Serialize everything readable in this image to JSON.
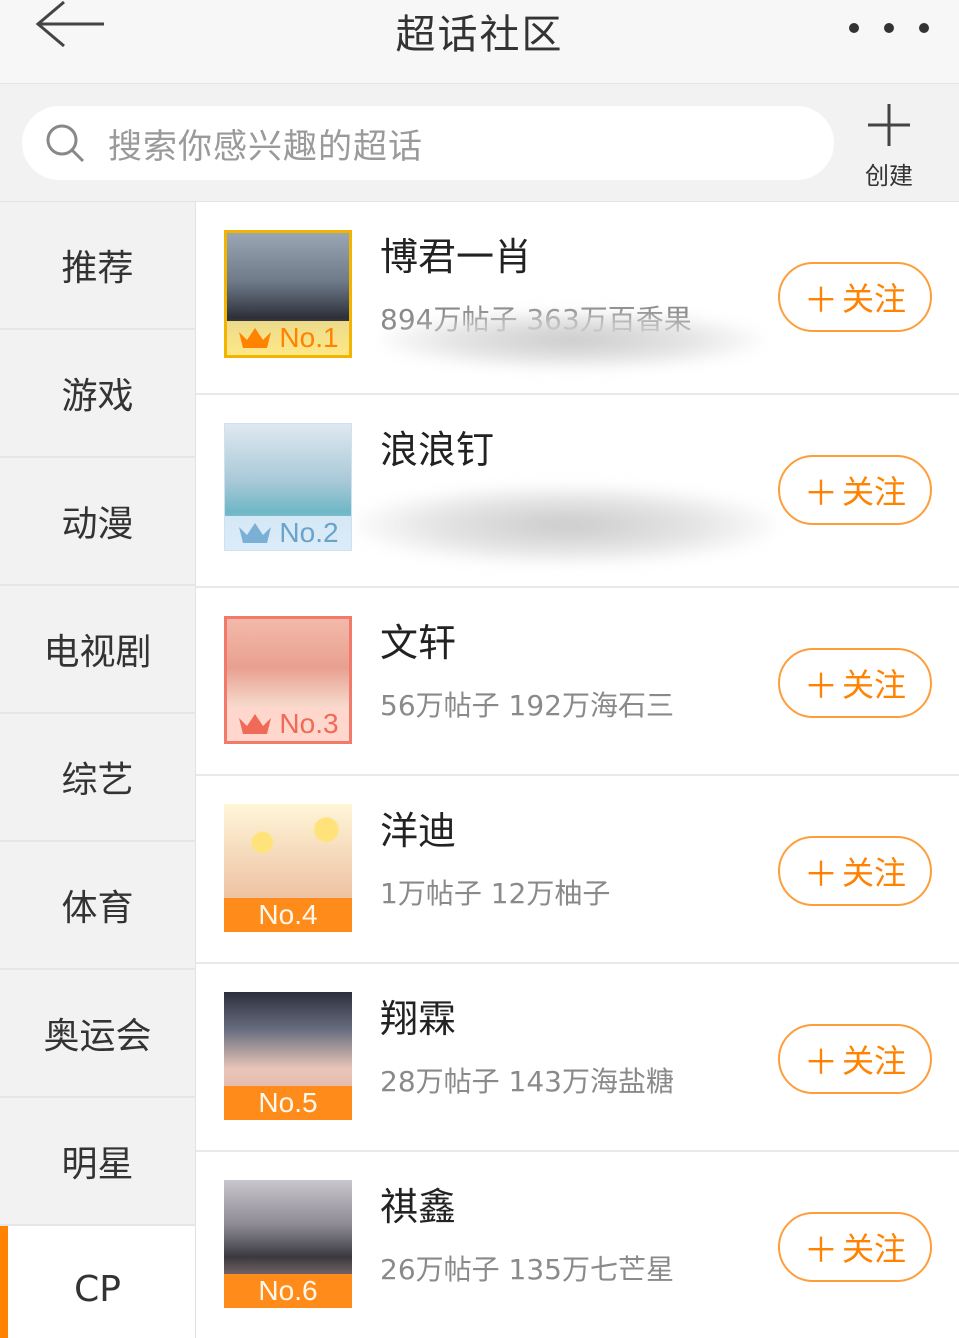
{
  "header": {
    "title": "超话社区",
    "back_icon": "arrow-left-icon",
    "more_icon": "more-dots-icon"
  },
  "search": {
    "placeholder": "搜索你感兴趣的超话",
    "create_label": "创建"
  },
  "sidebar": {
    "items": [
      {
        "label": "推荐"
      },
      {
        "label": "游戏"
      },
      {
        "label": "动漫"
      },
      {
        "label": "电视剧"
      },
      {
        "label": "综艺"
      },
      {
        "label": "体育"
      },
      {
        "label": "奥运会"
      },
      {
        "label": "明星"
      },
      {
        "label": "CP",
        "active": true
      }
    ]
  },
  "list": {
    "items": [
      {
        "rank": "No.1",
        "name": "博君一肖",
        "stats": "894万帖子 363万百香果",
        "follow": "关注"
      },
      {
        "rank": "No.2",
        "name": "浪浪钉",
        "stats": "",
        "follow": "关注"
      },
      {
        "rank": "No.3",
        "name": "文轩",
        "stats": "56万帖子 192万海石三",
        "follow": "关注"
      },
      {
        "rank": "No.4",
        "name": "洋迪",
        "stats": "1万帖子 12万柚子",
        "follow": "关注"
      },
      {
        "rank": "No.5",
        "name": "翔霖",
        "stats": "28万帖子 143万海盐糖",
        "follow": "关注"
      },
      {
        "rank": "No.6",
        "name": "祺鑫",
        "stats": "26万帖子 135万七芒星",
        "follow": "关注"
      }
    ]
  },
  "colors": {
    "accent": "#ff8200",
    "follow_border": "#ff9d3a",
    "rank_bar": "#ff8c1a"
  }
}
